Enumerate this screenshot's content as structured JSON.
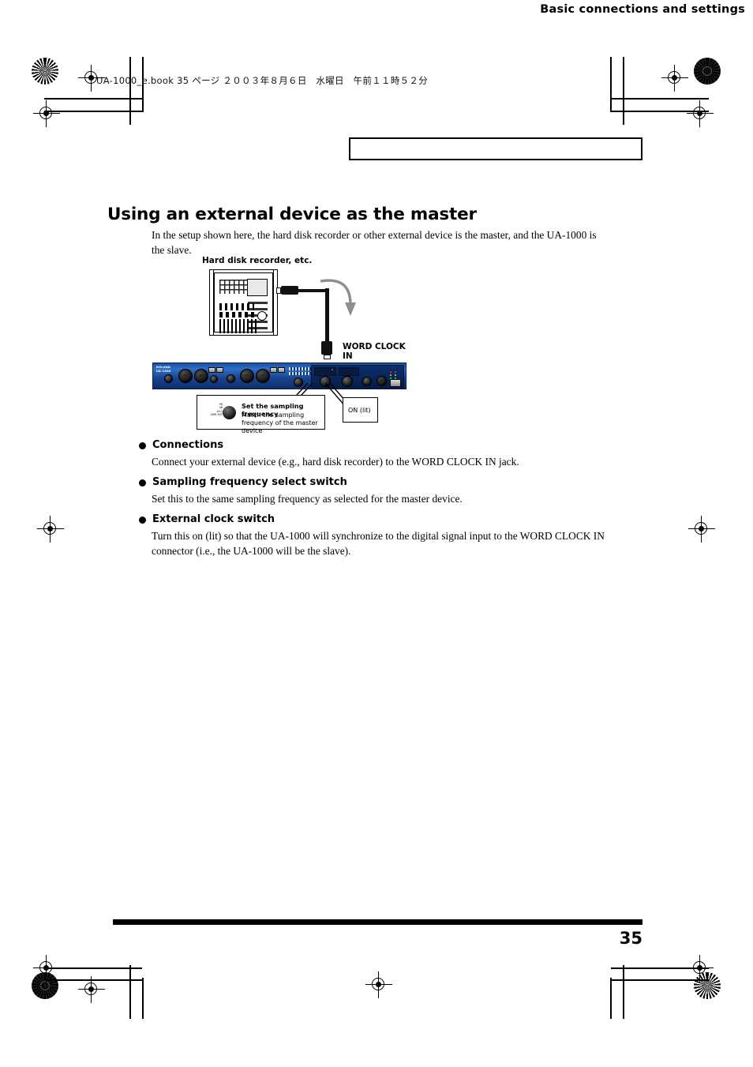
{
  "printer_info": {
    "file_line": "UA-1000_e.book  35 ページ  ２００３年８月６日　水曜日　午前１１時５２分"
  },
  "running_header": {
    "text": "Basic connections and settings"
  },
  "section": {
    "title": "Using an external device as the master",
    "intro": "In the setup shown here, the hard disk recorder or other external device is the master, and the UA-1000 is the slave."
  },
  "diagram": {
    "device_label": "Hard disk recorder, etc.",
    "word_clock_label_line1": "WORD CLOCK",
    "word_clock_label_line2": "IN",
    "callout_frequency": {
      "title": "Set the sampling frequency",
      "text": "Match the sampling frequency of the master device",
      "scale": [
        "96",
        "48",
        "",
        "44.1",
        "",
        "",
        "VARI EXT"
      ]
    },
    "callout_switch": {
      "label": "ON (lit)"
    },
    "unit_brand_line1": "ROLAND",
    "unit_brand_line2": "UA-1000"
  },
  "bullets": [
    {
      "heading": "Connections",
      "body": "Connect your external device (e.g., hard disk recorder) to the WORD CLOCK IN jack."
    },
    {
      "heading": "Sampling frequency select switch",
      "body": "Set this to the same sampling frequency as selected for the master device."
    },
    {
      "heading": "External clock switch",
      "body": "Turn this on (lit) so that the UA-1000 will synchronize to the digital signal input to the WORD CLOCK IN connector (i.e., the UA-1000 will be the slave)."
    }
  ],
  "footer": {
    "page_number": "35"
  },
  "colors": {
    "ink": "#000000",
    "panel_blue": "#1a4fa0",
    "panel_blue_dark": "#0e2f6b",
    "paper": "#ffffff"
  }
}
